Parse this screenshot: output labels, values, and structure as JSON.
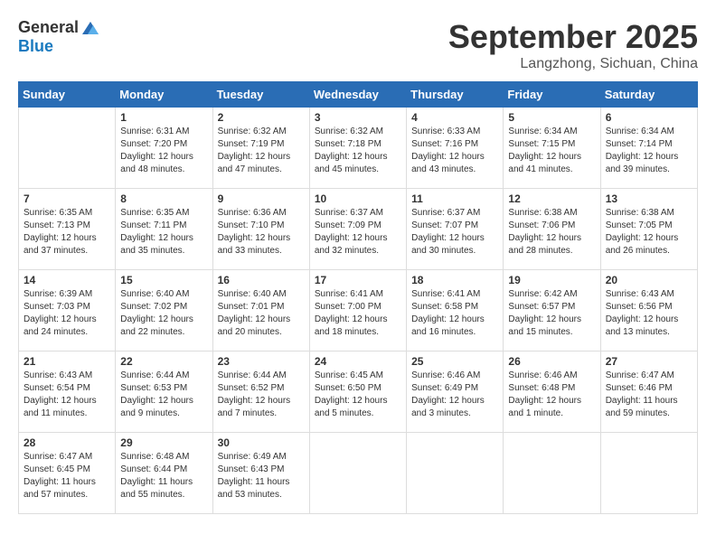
{
  "header": {
    "logo_general": "General",
    "logo_blue": "Blue",
    "title": "September 2025",
    "location": "Langzhong, Sichuan, China"
  },
  "weekdays": [
    "Sunday",
    "Monday",
    "Tuesday",
    "Wednesday",
    "Thursday",
    "Friday",
    "Saturday"
  ],
  "weeks": [
    [
      {
        "day": "",
        "sunrise": "",
        "sunset": "",
        "daylight": ""
      },
      {
        "day": "1",
        "sunrise": "Sunrise: 6:31 AM",
        "sunset": "Sunset: 7:20 PM",
        "daylight": "Daylight: 12 hours and 48 minutes."
      },
      {
        "day": "2",
        "sunrise": "Sunrise: 6:32 AM",
        "sunset": "Sunset: 7:19 PM",
        "daylight": "Daylight: 12 hours and 47 minutes."
      },
      {
        "day": "3",
        "sunrise": "Sunrise: 6:32 AM",
        "sunset": "Sunset: 7:18 PM",
        "daylight": "Daylight: 12 hours and 45 minutes."
      },
      {
        "day": "4",
        "sunrise": "Sunrise: 6:33 AM",
        "sunset": "Sunset: 7:16 PM",
        "daylight": "Daylight: 12 hours and 43 minutes."
      },
      {
        "day": "5",
        "sunrise": "Sunrise: 6:34 AM",
        "sunset": "Sunset: 7:15 PM",
        "daylight": "Daylight: 12 hours and 41 minutes."
      },
      {
        "day": "6",
        "sunrise": "Sunrise: 6:34 AM",
        "sunset": "Sunset: 7:14 PM",
        "daylight": "Daylight: 12 hours and 39 minutes."
      }
    ],
    [
      {
        "day": "7",
        "sunrise": "Sunrise: 6:35 AM",
        "sunset": "Sunset: 7:13 PM",
        "daylight": "Daylight: 12 hours and 37 minutes."
      },
      {
        "day": "8",
        "sunrise": "Sunrise: 6:35 AM",
        "sunset": "Sunset: 7:11 PM",
        "daylight": "Daylight: 12 hours and 35 minutes."
      },
      {
        "day": "9",
        "sunrise": "Sunrise: 6:36 AM",
        "sunset": "Sunset: 7:10 PM",
        "daylight": "Daylight: 12 hours and 33 minutes."
      },
      {
        "day": "10",
        "sunrise": "Sunrise: 6:37 AM",
        "sunset": "Sunset: 7:09 PM",
        "daylight": "Daylight: 12 hours and 32 minutes."
      },
      {
        "day": "11",
        "sunrise": "Sunrise: 6:37 AM",
        "sunset": "Sunset: 7:07 PM",
        "daylight": "Daylight: 12 hours and 30 minutes."
      },
      {
        "day": "12",
        "sunrise": "Sunrise: 6:38 AM",
        "sunset": "Sunset: 7:06 PM",
        "daylight": "Daylight: 12 hours and 28 minutes."
      },
      {
        "day": "13",
        "sunrise": "Sunrise: 6:38 AM",
        "sunset": "Sunset: 7:05 PM",
        "daylight": "Daylight: 12 hours and 26 minutes."
      }
    ],
    [
      {
        "day": "14",
        "sunrise": "Sunrise: 6:39 AM",
        "sunset": "Sunset: 7:03 PM",
        "daylight": "Daylight: 12 hours and 24 minutes."
      },
      {
        "day": "15",
        "sunrise": "Sunrise: 6:40 AM",
        "sunset": "Sunset: 7:02 PM",
        "daylight": "Daylight: 12 hours and 22 minutes."
      },
      {
        "day": "16",
        "sunrise": "Sunrise: 6:40 AM",
        "sunset": "Sunset: 7:01 PM",
        "daylight": "Daylight: 12 hours and 20 minutes."
      },
      {
        "day": "17",
        "sunrise": "Sunrise: 6:41 AM",
        "sunset": "Sunset: 7:00 PM",
        "daylight": "Daylight: 12 hours and 18 minutes."
      },
      {
        "day": "18",
        "sunrise": "Sunrise: 6:41 AM",
        "sunset": "Sunset: 6:58 PM",
        "daylight": "Daylight: 12 hours and 16 minutes."
      },
      {
        "day": "19",
        "sunrise": "Sunrise: 6:42 AM",
        "sunset": "Sunset: 6:57 PM",
        "daylight": "Daylight: 12 hours and 15 minutes."
      },
      {
        "day": "20",
        "sunrise": "Sunrise: 6:43 AM",
        "sunset": "Sunset: 6:56 PM",
        "daylight": "Daylight: 12 hours and 13 minutes."
      }
    ],
    [
      {
        "day": "21",
        "sunrise": "Sunrise: 6:43 AM",
        "sunset": "Sunset: 6:54 PM",
        "daylight": "Daylight: 12 hours and 11 minutes."
      },
      {
        "day": "22",
        "sunrise": "Sunrise: 6:44 AM",
        "sunset": "Sunset: 6:53 PM",
        "daylight": "Daylight: 12 hours and 9 minutes."
      },
      {
        "day": "23",
        "sunrise": "Sunrise: 6:44 AM",
        "sunset": "Sunset: 6:52 PM",
        "daylight": "Daylight: 12 hours and 7 minutes."
      },
      {
        "day": "24",
        "sunrise": "Sunrise: 6:45 AM",
        "sunset": "Sunset: 6:50 PM",
        "daylight": "Daylight: 12 hours and 5 minutes."
      },
      {
        "day": "25",
        "sunrise": "Sunrise: 6:46 AM",
        "sunset": "Sunset: 6:49 PM",
        "daylight": "Daylight: 12 hours and 3 minutes."
      },
      {
        "day": "26",
        "sunrise": "Sunrise: 6:46 AM",
        "sunset": "Sunset: 6:48 PM",
        "daylight": "Daylight: 12 hours and 1 minute."
      },
      {
        "day": "27",
        "sunrise": "Sunrise: 6:47 AM",
        "sunset": "Sunset: 6:46 PM",
        "daylight": "Daylight: 11 hours and 59 minutes."
      }
    ],
    [
      {
        "day": "28",
        "sunrise": "Sunrise: 6:47 AM",
        "sunset": "Sunset: 6:45 PM",
        "daylight": "Daylight: 11 hours and 57 minutes."
      },
      {
        "day": "29",
        "sunrise": "Sunrise: 6:48 AM",
        "sunset": "Sunset: 6:44 PM",
        "daylight": "Daylight: 11 hours and 55 minutes."
      },
      {
        "day": "30",
        "sunrise": "Sunrise: 6:49 AM",
        "sunset": "Sunset: 6:43 PM",
        "daylight": "Daylight: 11 hours and 53 minutes."
      },
      {
        "day": "",
        "sunrise": "",
        "sunset": "",
        "daylight": ""
      },
      {
        "day": "",
        "sunrise": "",
        "sunset": "",
        "daylight": ""
      },
      {
        "day": "",
        "sunrise": "",
        "sunset": "",
        "daylight": ""
      },
      {
        "day": "",
        "sunrise": "",
        "sunset": "",
        "daylight": ""
      }
    ]
  ]
}
